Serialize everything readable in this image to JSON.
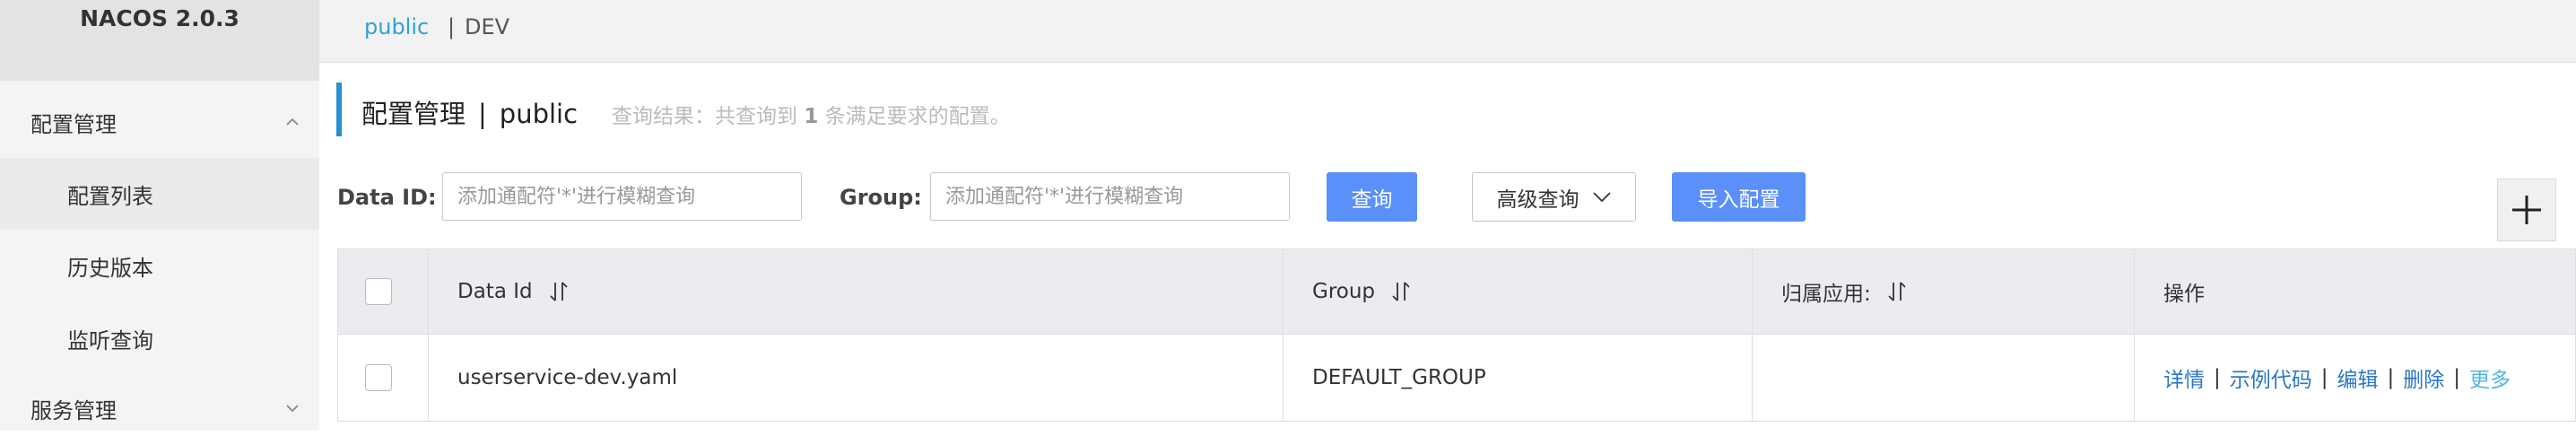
{
  "app": {
    "title": "NACOS 2.0.3"
  },
  "sidebar": {
    "groups": [
      {
        "label": "配置管理",
        "expanded": true,
        "items": [
          {
            "label": "配置列表",
            "active": true
          },
          {
            "label": "历史版本",
            "active": false
          },
          {
            "label": "监听查询",
            "active": false
          }
        ]
      },
      {
        "label": "服务管理",
        "expanded": false
      }
    ]
  },
  "namespace_bar": {
    "current": "public",
    "separator": "|",
    "other": "DEV"
  },
  "header": {
    "title": "配置管理",
    "separator": "|",
    "namespace": "public",
    "query_result_prefix": "查询结果：共查询到",
    "query_result_count": "1",
    "query_result_suffix": "条满足要求的配置。"
  },
  "filters": {
    "data_id_label": "Data ID:",
    "data_id_value": "",
    "data_id_placeholder": "添加通配符'*'进行模糊查询",
    "group_label": "Group:",
    "group_value": "",
    "group_placeholder": "添加通配符'*'进行模糊查询",
    "query_button": "查询",
    "advanced_query_button": "高级查询",
    "import_button": "导入配置"
  },
  "table": {
    "columns": [
      {
        "label": "Data Id",
        "sortable": true
      },
      {
        "label": "Group",
        "sortable": true
      },
      {
        "label": "归属应用:",
        "sortable": true
      },
      {
        "label": "操作",
        "sortable": false
      }
    ],
    "rows": [
      {
        "data_id": "userservice-dev.yaml",
        "group": "DEFAULT_GROUP",
        "app": ""
      }
    ],
    "actions": {
      "details": "详情",
      "sample_code": "示例代码",
      "edit": "编辑",
      "delete": "删除",
      "more": "更多",
      "separator": "|"
    }
  },
  "colors": {
    "primary": "#5b8ff9",
    "link": "#2b77c5",
    "namespace_link": "#33a1d2",
    "title_accent": "#2a8fcf",
    "sidebar_bg": "#f4f4f4",
    "header_bg": "#ebecf0"
  },
  "icons": {
    "collapse": "chevron-up-icon",
    "expand": "chevron-down-icon",
    "sort": "sort-arrows-icon",
    "dropdown": "chevron-down-icon",
    "add": "plus-icon"
  }
}
